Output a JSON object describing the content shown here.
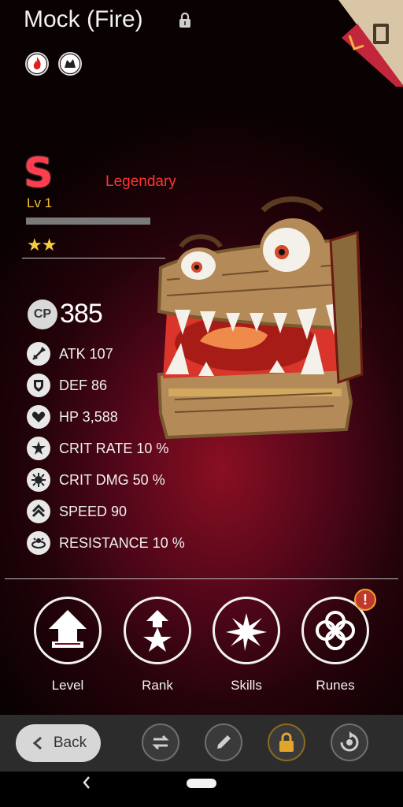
{
  "header": {
    "title": "Mock (Fire)"
  },
  "monster": {
    "grade": "S",
    "rarity": "Legendary",
    "level": "Lv 1",
    "stars": "★★",
    "xp_progress": 0.0,
    "cp_badge": "CP",
    "cp_value": "385"
  },
  "stats": [
    {
      "icon": "sword-icon",
      "label": "ATK 107"
    },
    {
      "icon": "shield-icon",
      "label": "DEF 86"
    },
    {
      "icon": "heart-icon",
      "label": "HP 3,588"
    },
    {
      "icon": "crit-rate-icon",
      "label": "CRIT RATE 10 %"
    },
    {
      "icon": "crit-dmg-icon",
      "label": "CRIT DMG 50 %"
    },
    {
      "icon": "speed-icon",
      "label": "SPEED 90"
    },
    {
      "icon": "resistance-icon",
      "label": "RESISTANCE 10 %"
    }
  ],
  "actions": [
    {
      "label": "Level",
      "icon": "level-up-icon"
    },
    {
      "label": "Rank",
      "icon": "rank-up-icon"
    },
    {
      "label": "Skills",
      "icon": "skills-icon"
    },
    {
      "label": "Runes",
      "icon": "runes-icon"
    }
  ],
  "alert_badge": "!",
  "bottom_bar": {
    "back_label": "Back"
  },
  "colors": {
    "grade": "#ff3d4d",
    "rarity": "#ff3535",
    "level": "#f2c42a",
    "stars": "#f6cc3a"
  }
}
